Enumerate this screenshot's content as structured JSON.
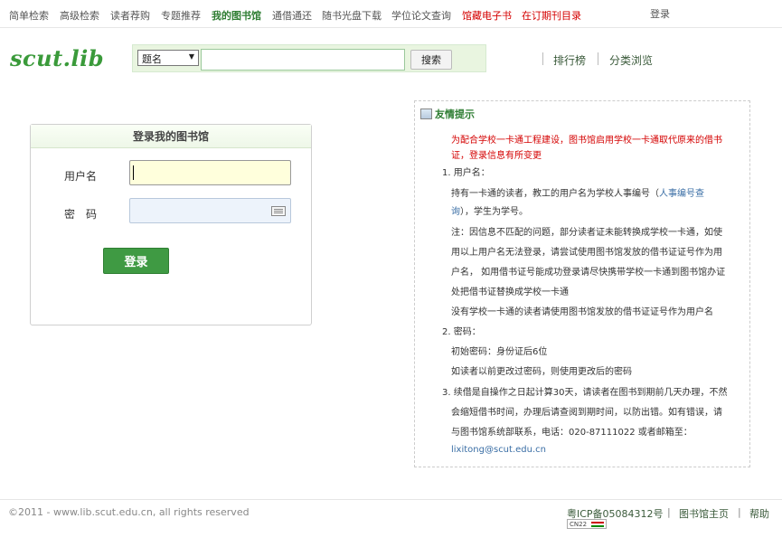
{
  "nav": {
    "items": [
      "简单检索",
      "高级检索",
      "读者荐购",
      "专题推荐",
      "我的图书馆",
      "通借通还",
      "随书光盘下载",
      "学位论文查询",
      "馆藏电子书",
      "在订期刊目录"
    ],
    "login": "登录"
  },
  "logo": "scut.lib",
  "search": {
    "field": "题名",
    "query": "",
    "button": "搜索"
  },
  "links": {
    "ranking": "排行榜",
    "browse": "分类浏览"
  },
  "login_box": {
    "title": "登录我的图书馆",
    "user_label": "用户名",
    "pwd_label": "密　码",
    "submit": "登录"
  },
  "notice": {
    "title": "友情提示",
    "intro1": "为配合学校一卡通工程建设，图书馆启用学校一卡通取代原来的借书",
    "intro2": "证，登录信息有所变更",
    "s1": "1. 用户名：",
    "p1a": "持有一卡通的读者，教工的用户名为学校人事编号（",
    "p1link": "人事编号查",
    "p1link2": "询",
    "p1b": "），学生为学号。",
    "p2a": "注：因信息不匹配的问题，部分读者证未能转换成学校一卡通，如使",
    "p2b": "用以上用户名无法登录，请尝试使用图书馆发放的借书证证号作为用",
    "p2c": "户名，  如用借书证号能成功登录请尽快携带学校一卡通到图书馆办证",
    "p2d": "处把借书证替换成学校一卡通",
    "p3": "没有学校一卡通的读者请使用图书馆发放的借书证证号作为用户名",
    "s2": "2. 密码：",
    "p4": "初始密码：身份证后6位",
    "p5": "如读者以前更改过密码，则使用更改后的密码",
    "s3a": "3. 续借是自操作之日起计算30天，请读者在图书到期前几天办理，不然",
    "s3b": "会缩短借书时间，办理后请查阅到期时间，以防出错。如有错误，请",
    "s3c": "与图书馆系统部联系，电话：020-87111022 或者邮箱至：",
    "email": "lixitong@scut.edu.cn"
  },
  "footer": {
    "copyright": "©2011 -  www.lib.scut.edu.cn, all rights reserved",
    "icp": "粤ICP备05084312号",
    "sep": "|",
    "home": "图书馆主页",
    "help": "帮助",
    "badge": "CN22"
  },
  "colors": {
    "brand_green": "#3a9a3a",
    "nav_active": "#2e7d32",
    "nav_red": "#d40000"
  }
}
